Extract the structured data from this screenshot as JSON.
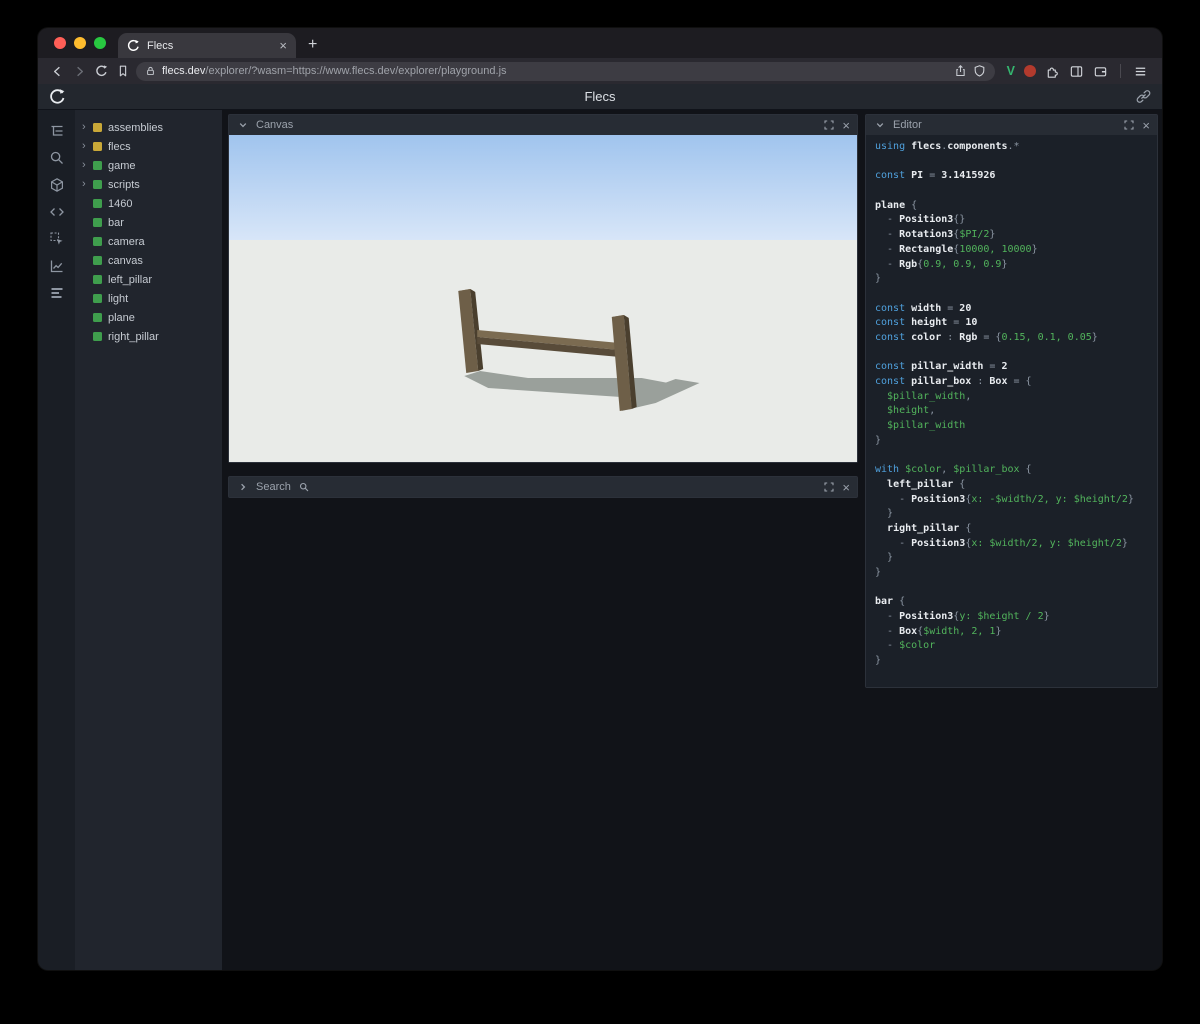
{
  "glyphs": {
    "close": "×",
    "new_tab": "+"
  },
  "browser": {
    "tab_title": "Flecs",
    "url_host": "flecs.dev",
    "url_path": "/explorer/?wasm=https://www.flecs.dev/explorer/playground.js"
  },
  "app_header": {
    "title": "Flecs"
  },
  "activity_bar": {
    "icons": [
      "outliner-icon",
      "search-icon",
      "entities-cube-icon",
      "code-icon",
      "inspect-icon",
      "chart-icon",
      "stats-icon"
    ]
  },
  "tree": {
    "items": [
      {
        "label": "assemblies",
        "expandable": true,
        "color": "#c9a838"
      },
      {
        "label": "flecs",
        "expandable": true,
        "color": "#c9a838"
      },
      {
        "label": "game",
        "expandable": true,
        "color": "#3f9e4d"
      },
      {
        "label": "scripts",
        "expandable": true,
        "color": "#3f9e4d"
      },
      {
        "label": "1460",
        "expandable": false,
        "color": "#3f9e4d"
      },
      {
        "label": "bar",
        "expandable": false,
        "color": "#3f9e4d"
      },
      {
        "label": "camera",
        "expandable": false,
        "color": "#3f9e4d"
      },
      {
        "label": "canvas",
        "expandable": false,
        "color": "#3f9e4d"
      },
      {
        "label": "left_pillar",
        "expandable": false,
        "color": "#3f9e4d"
      },
      {
        "label": "light",
        "expandable": false,
        "color": "#3f9e4d"
      },
      {
        "label": "plane",
        "expandable": false,
        "color": "#3f9e4d"
      },
      {
        "label": "right_pillar",
        "expandable": false,
        "color": "#3f9e4d"
      }
    ]
  },
  "canvas_panel": {
    "title": "Canvas",
    "scene": {
      "sky_top": "#a0c4ee",
      "sky_horizon": "#d8e6f8",
      "ground": "#e9ebe8",
      "pillar_front": "#6e5f48",
      "pillar_side": "#4a3f2e",
      "pillar_top": "#8a795c",
      "bar_top": "#7b6b51",
      "bar_front": "#584b39",
      "shadow": "#9aa09b"
    }
  },
  "search_panel": {
    "title": "Search"
  },
  "editor_panel": {
    "title": "Editor",
    "code_lines": [
      [
        [
          "kw",
          "using "
        ],
        [
          "id",
          "flecs"
        ],
        [
          "pn",
          "."
        ],
        [
          "id",
          "components"
        ],
        [
          "pn",
          ".*"
        ]
      ],
      [],
      [
        [
          "kw",
          "const "
        ],
        [
          "id",
          "PI"
        ],
        [
          "pn",
          " = "
        ],
        [
          "num",
          "3.1415926"
        ]
      ],
      [],
      [
        [
          "id",
          "plane"
        ],
        [
          "pn",
          " {"
        ]
      ],
      [
        [
          "pn",
          "  - "
        ],
        [
          "id",
          "Position3"
        ],
        [
          "pn",
          "{}"
        ]
      ],
      [
        [
          "pn",
          "  - "
        ],
        [
          "id",
          "Rotation3"
        ],
        [
          "pn",
          "{"
        ],
        [
          "val",
          "$PI/2"
        ],
        [
          "pn",
          "}"
        ]
      ],
      [
        [
          "pn",
          "  - "
        ],
        [
          "id",
          "Rectangle"
        ],
        [
          "pn",
          "{"
        ],
        [
          "val",
          "10000, 10000"
        ],
        [
          "pn",
          "}"
        ]
      ],
      [
        [
          "pn",
          "  - "
        ],
        [
          "id",
          "Rgb"
        ],
        [
          "pn",
          "{"
        ],
        [
          "val",
          "0.9, 0.9, 0.9"
        ],
        [
          "pn",
          "}"
        ]
      ],
      [
        [
          "pn",
          "}"
        ]
      ],
      [],
      [
        [
          "kw",
          "const "
        ],
        [
          "id",
          "width"
        ],
        [
          "pn",
          " = "
        ],
        [
          "num",
          "20"
        ]
      ],
      [
        [
          "kw",
          "const "
        ],
        [
          "id",
          "height"
        ],
        [
          "pn",
          " = "
        ],
        [
          "num",
          "10"
        ]
      ],
      [
        [
          "kw",
          "const "
        ],
        [
          "id",
          "color"
        ],
        [
          "pn",
          " : "
        ],
        [
          "id",
          "Rgb"
        ],
        [
          "pn",
          " = {"
        ],
        [
          "val",
          "0.15, 0.1, 0.05"
        ],
        [
          "pn",
          "}"
        ]
      ],
      [],
      [
        [
          "kw",
          "const "
        ],
        [
          "id",
          "pillar_width"
        ],
        [
          "pn",
          " = "
        ],
        [
          "num",
          "2"
        ]
      ],
      [
        [
          "kw",
          "const "
        ],
        [
          "id",
          "pillar_box"
        ],
        [
          "pn",
          " : "
        ],
        [
          "id",
          "Box"
        ],
        [
          "pn",
          " = {"
        ]
      ],
      [
        [
          "val",
          "  $pillar_width"
        ],
        [
          "pn",
          ","
        ]
      ],
      [
        [
          "val",
          "  $height"
        ],
        [
          "pn",
          ","
        ]
      ],
      [
        [
          "val",
          "  $pillar_width"
        ]
      ],
      [
        [
          "pn",
          "}"
        ]
      ],
      [],
      [
        [
          "kw",
          "with "
        ],
        [
          "val",
          "$color"
        ],
        [
          "pn",
          ", "
        ],
        [
          "val",
          "$pillar_box"
        ],
        [
          "pn",
          " {"
        ]
      ],
      [
        [
          "pn",
          "  "
        ],
        [
          "id",
          "left_pillar"
        ],
        [
          "pn",
          " {"
        ]
      ],
      [
        [
          "pn",
          "    - "
        ],
        [
          "id",
          "Position3"
        ],
        [
          "pn",
          "{"
        ],
        [
          "val",
          "x: -$width/2, y: $height/2"
        ],
        [
          "pn",
          "}"
        ]
      ],
      [
        [
          "pn",
          "  }"
        ]
      ],
      [
        [
          "pn",
          "  "
        ],
        [
          "id",
          "right_pillar"
        ],
        [
          "pn",
          " {"
        ]
      ],
      [
        [
          "pn",
          "    - "
        ],
        [
          "id",
          "Position3"
        ],
        [
          "pn",
          "{"
        ],
        [
          "val",
          "x: $width/2, y: $height/2"
        ],
        [
          "pn",
          "}"
        ]
      ],
      [
        [
          "pn",
          "  }"
        ]
      ],
      [
        [
          "pn",
          "}"
        ]
      ],
      [],
      [
        [
          "id",
          "bar"
        ],
        [
          "pn",
          " {"
        ]
      ],
      [
        [
          "pn",
          "  - "
        ],
        [
          "id",
          "Position3"
        ],
        [
          "pn",
          "{"
        ],
        [
          "val",
          "y: $height / 2"
        ],
        [
          "pn",
          "}"
        ]
      ],
      [
        [
          "pn",
          "  - "
        ],
        [
          "id",
          "Box"
        ],
        [
          "pn",
          "{"
        ],
        [
          "val",
          "$width, 2, 1"
        ],
        [
          "pn",
          "}"
        ]
      ],
      [
        [
          "pn",
          "  - "
        ],
        [
          "val",
          "$color"
        ]
      ],
      [
        [
          "pn",
          "}"
        ]
      ]
    ]
  }
}
